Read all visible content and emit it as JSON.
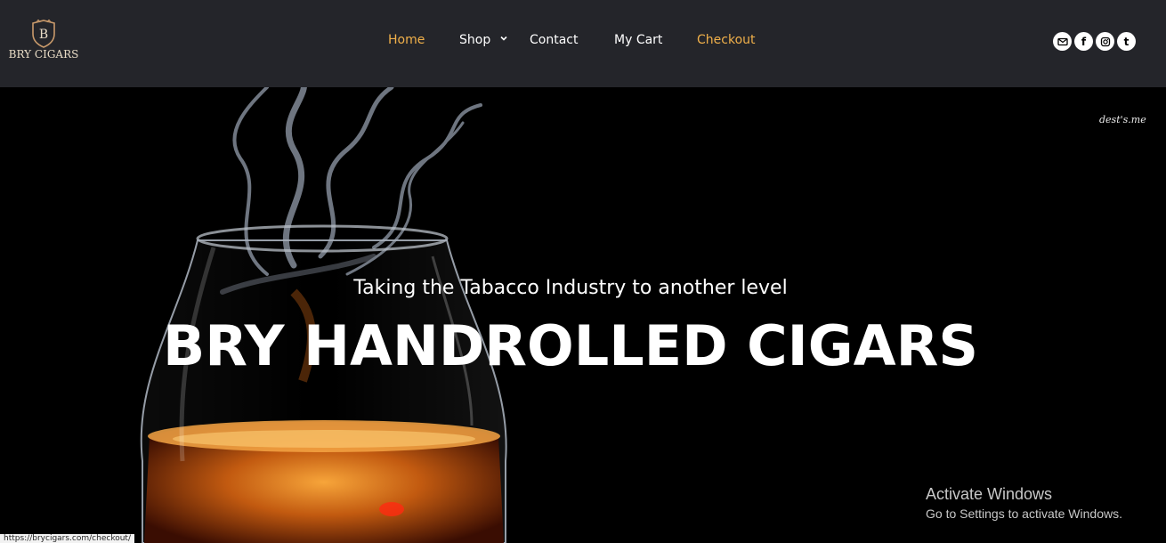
{
  "brand": {
    "name": "BRY CIGARS",
    "logo_icon": "b-crest-icon",
    "logo_color": "#e9dcc6"
  },
  "nav": {
    "items": [
      {
        "label": "Home",
        "state": "active",
        "color": "#f0b04a"
      },
      {
        "label": "Shop",
        "has_dropdown": true,
        "color": "#ffffff"
      },
      {
        "label": "Contact",
        "color": "#ffffff"
      },
      {
        "label": "My Cart",
        "color": "#ffffff"
      },
      {
        "label": "Checkout",
        "color": "#f0b04a"
      }
    ]
  },
  "socials": [
    {
      "icon": "envelope-icon"
    },
    {
      "icon": "facebook-icon",
      "glyph": "f"
    },
    {
      "icon": "instagram-icon"
    },
    {
      "icon": "tumblr-icon",
      "glyph": "t"
    }
  ],
  "hero": {
    "tagline": "Taking the Tabacco Industry to another level",
    "headline": "BRY HANDROLLED CIGARS",
    "watermark": "dest's.me"
  },
  "os_overlay": {
    "title": "Activate Windows",
    "subtitle": "Go to Settings to activate Windows."
  },
  "status_bar": {
    "url": "https://brycigars.com/checkout/"
  },
  "colors": {
    "header_bg": "#24252a",
    "accent": "#f0b04a",
    "hero_bg": "#000000"
  }
}
